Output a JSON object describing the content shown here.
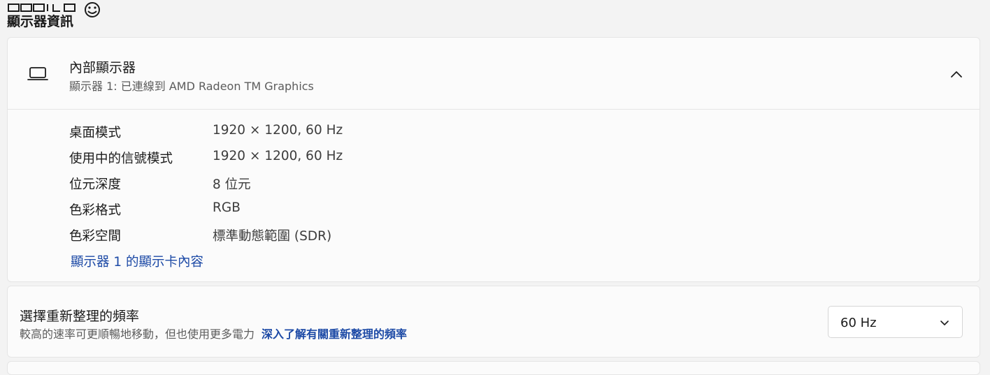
{
  "header": {
    "logo": "MOBILE01",
    "title": "顯示器資訊"
  },
  "display_card": {
    "title": "內部顯示器",
    "subtitle": "顯示器 1: 已連線到 AMD Radeon TM Graphics",
    "rows": [
      {
        "label": "桌面模式",
        "value": "1920 × 1200, 60 Hz"
      },
      {
        "label": "使用中的信號模式",
        "value": "1920 × 1200, 60 Hz"
      },
      {
        "label": "位元深度",
        "value": "8 位元"
      },
      {
        "label": "色彩格式",
        "value": "RGB"
      },
      {
        "label": "色彩空間",
        "value": "標準動態範圍 (SDR)"
      }
    ],
    "adapter_link": "顯示器 1 的顯示卡內容"
  },
  "refresh_card": {
    "title": "選擇重新整理的頻率",
    "description": "較高的速率可更順暢地移動，但也使用更多電力",
    "learn_more_link": "深入了解有關重新整理的頻率",
    "selected_rate": "60 Hz"
  },
  "icons": {
    "display": "laptop-icon",
    "collapse": "chevron-up-icon",
    "dropdown": "chevron-down-icon"
  },
  "colors": {
    "link": "#1d4aa6",
    "background": "#f3f3f3",
    "card": "#fbfbfb"
  }
}
